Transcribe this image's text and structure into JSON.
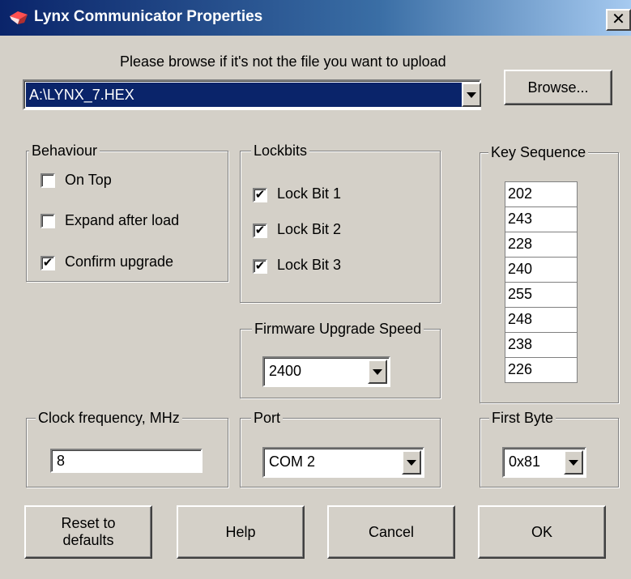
{
  "window": {
    "title": "Lynx Communicator Properties",
    "close_glyph": "✕"
  },
  "file": {
    "prompt": "Please browse if it's not the file you want to upload",
    "value": "A:\\LYNX_7.HEX",
    "browse_label": "Browse..."
  },
  "behaviour": {
    "legend": "Behaviour",
    "items": [
      {
        "label": "On Top",
        "checked": false
      },
      {
        "label": "Expand after load",
        "checked": false
      },
      {
        "label": "Confirm upgrade",
        "checked": true
      }
    ]
  },
  "lockbits": {
    "legend": "Lockbits",
    "items": [
      {
        "label": "Lock Bit 1",
        "checked": true
      },
      {
        "label": "Lock Bit 2",
        "checked": true
      },
      {
        "label": "Lock Bit 3",
        "checked": true
      }
    ]
  },
  "key_sequence": {
    "legend": "Key Sequence",
    "values": [
      "202",
      "243",
      "228",
      "240",
      "255",
      "248",
      "238",
      "226"
    ]
  },
  "firmware_speed": {
    "legend": "Firmware Upgrade Speed",
    "value": "2400"
  },
  "clock": {
    "legend": "Clock frequency, MHz",
    "value": "8"
  },
  "port": {
    "legend": "Port",
    "value": "COM 2"
  },
  "first_byte": {
    "legend": "First Byte",
    "value": "0x81"
  },
  "buttons": {
    "reset_line1": "Reset to",
    "reset_line2": "defaults",
    "help": "Help",
    "cancel": "Cancel",
    "ok": "OK"
  },
  "icons": {
    "title": "lynx-app-icon",
    "dropdown": "chevron-down-icon"
  },
  "colors": {
    "title_start": "#0a246a",
    "title_end": "#a6caf0",
    "selection": "#0a246a",
    "face": "#d4d0c8"
  }
}
